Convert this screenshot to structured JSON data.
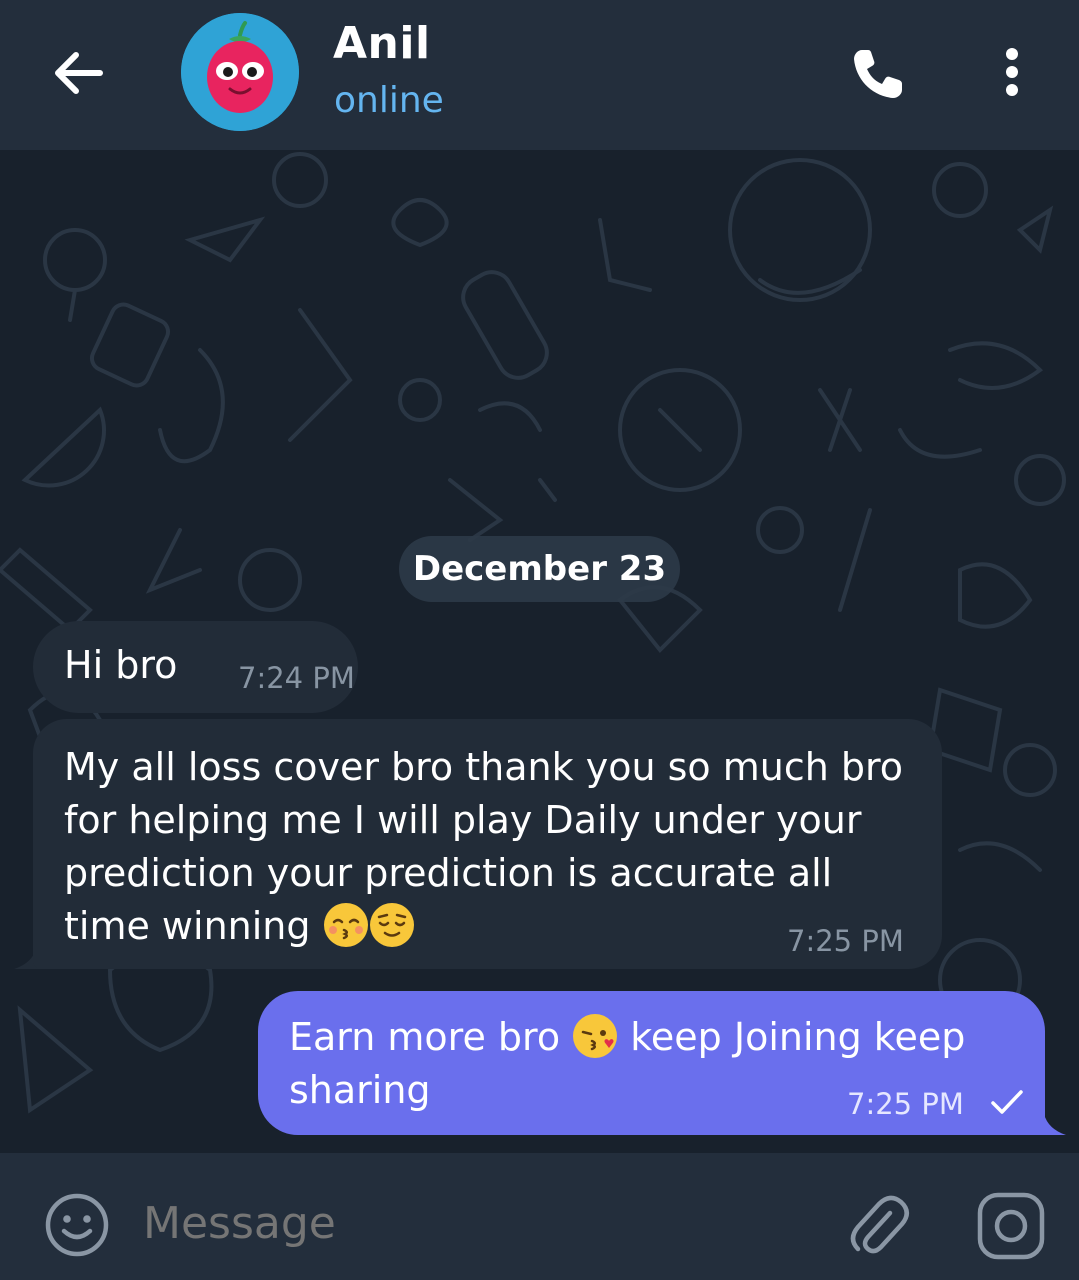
{
  "header": {
    "contact_name": "Anil",
    "status": "online",
    "back_icon": "arrow-left-icon",
    "call_icon": "phone-icon",
    "menu_icon": "more-vertical-icon"
  },
  "chat": {
    "date_separator": "December 23",
    "messages": [
      {
        "direction": "incoming",
        "text": "Hi bro",
        "time": "7:24 PM"
      },
      {
        "direction": "incoming",
        "text_parts": [
          "My all loss cover bro thank you so much bro for helping me I will play Daily under your prediction your prediction is accurate all time winning "
        ],
        "emojis": [
          "kissing-face-closed-eyes",
          "relieved-face"
        ],
        "time": "7:25 PM"
      },
      {
        "direction": "outgoing",
        "text_parts": [
          "Earn more bro ",
          " keep Joining keep sharing"
        ],
        "emojis": [
          "face-blowing-kiss"
        ],
        "time": "7:25 PM",
        "status_icon": "check-icon"
      }
    ]
  },
  "composer": {
    "placeholder": "Message",
    "emoji_icon": "smile-icon",
    "attach_icon": "paperclip-icon",
    "camera_icon": "camera-icon"
  },
  "colors": {
    "header_bg": "#232e3c",
    "chat_bg": "#18212c",
    "incoming_bubble": "#222c38",
    "outgoing_bubble": "#6a6fed",
    "status_blue": "#64b5f0"
  }
}
